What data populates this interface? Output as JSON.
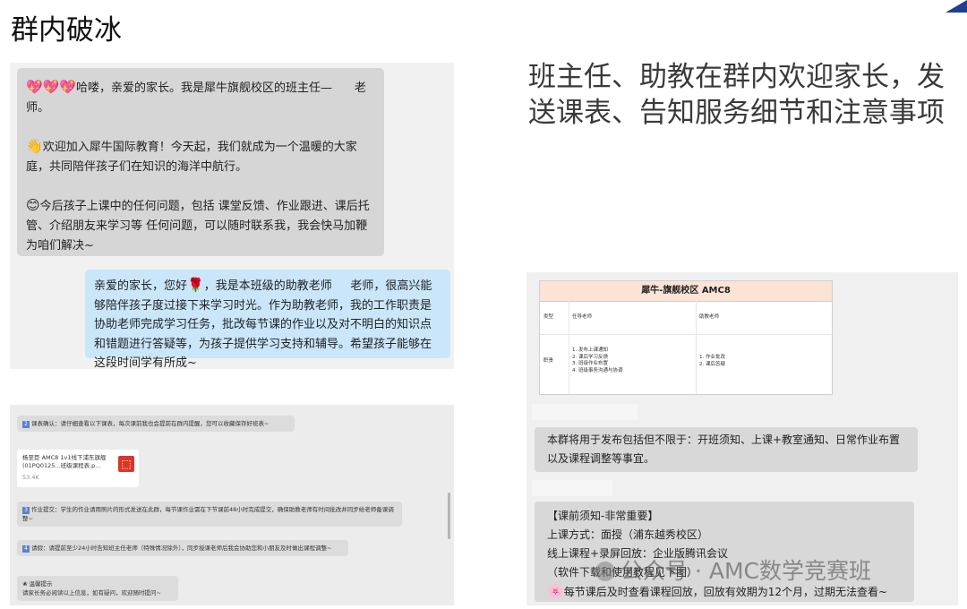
{
  "slide": {
    "title": "群内破冰"
  },
  "right_heading": "班主任、助教在群内欢迎家长，发送课表、告知服务细节和注意事项",
  "left_chat": {
    "teacher_message": {
      "emoji": "💖💖💖",
      "line1": "哈喽，亲爱的家长。我是犀牛旗舰校区的班主任—",
      "line1_end": "老",
      "line2": "师。",
      "p2_emoji": "👋",
      "p2": "欢迎加入犀牛国际教育！今天起，我们就成为一个温暖的大家庭，共同陪伴孩子们在知识的海洋中航行。",
      "p3_emoji": "😊",
      "p3": "今后孩子上课中的任何问题，包括 课堂反馈、作业跟进、课后托管、介绍朋友来学习等 任何问题，可以随时联系我，我会快马加鞭为咱们解决~"
    },
    "assistant_message": {
      "part1": "亲爱的家长，您好",
      "emoji": "🌹",
      "part2": "，我是本班级的助教老师",
      "part3": "老师，很高兴能够陪伴孩子度过接下来学习时光。作为助教老师，我的工作职责是协助老师完成学习任务，批改每节课的作业以及对不明白的知识点和错题进行答疑等，为孩子提供学习支持和辅导。希望孩子能够在这段时间学有所成~"
    }
  },
  "left_bottom": {
    "msg1_num": "2",
    "msg1": "课表确认：请仔细查看以下课表，每次课前我也会提前在群内提醒，您可以收藏保存好班表~",
    "file": {
      "name": "杨至臣 AMC8 1v1线下浦东旗舰(01PQ0125...班级课程表.p...",
      "size": "53.4K",
      "icon": "pdf-icon"
    },
    "msg2_num": "3",
    "msg2": "作业提交：学生的作业请用照片的形式发送在此群，每节课作业需在下节课前48小时完成提交，确保助教老师有时间批改并同步给老师备课调整~",
    "msg3_num": "4",
    "msg3": "请假：请提前至少24小时告知班主任老师（特殊情况除外），同步授课老师后我会协助您和小朋友及时做出课程调整~",
    "msg4_title": "温馨提示",
    "msg4": "请家长务必阅读以上信息，如有疑问，欢迎随时提问~"
  },
  "right_panel": {
    "table": {
      "title": "犀牛-旗舰校区 AMC8",
      "col1": "类型",
      "col2": "任导老师",
      "col3": "助教老师",
      "row_label": "职责",
      "duties_main": [
        "1. 发布上课通知",
        "2. 课后学习反馈",
        "3. 班级作业布置",
        "4. 班级事务沟通与协调"
      ],
      "duties_assistant": [
        "1. 作业批改",
        "2. 课后答疑"
      ]
    },
    "notice": "本群将用于发布包括但不限于：开班须知、上课+教室通知、日常作业布置以及课程调整等事宜。",
    "pre_class": {
      "title": "【课前须知-非常重要】",
      "line1": "上课方式：面授（浦东越秀校区）",
      "line2": "线上课程+录屏回放：企业版腾讯会议",
      "line3": "（软件下载和使用教程见下图）",
      "line4_emoji": "🌸",
      "line4": "每节课后及时查看课程回放，回放有效期为12个月，过期无法查看~"
    }
  },
  "watermark": "公众号 · AMC数学竞赛班",
  "colors": {
    "accent_corner": "#1f3f8f",
    "bubble_user": "#c9e6fa",
    "table_header": "#fbe3d6"
  }
}
